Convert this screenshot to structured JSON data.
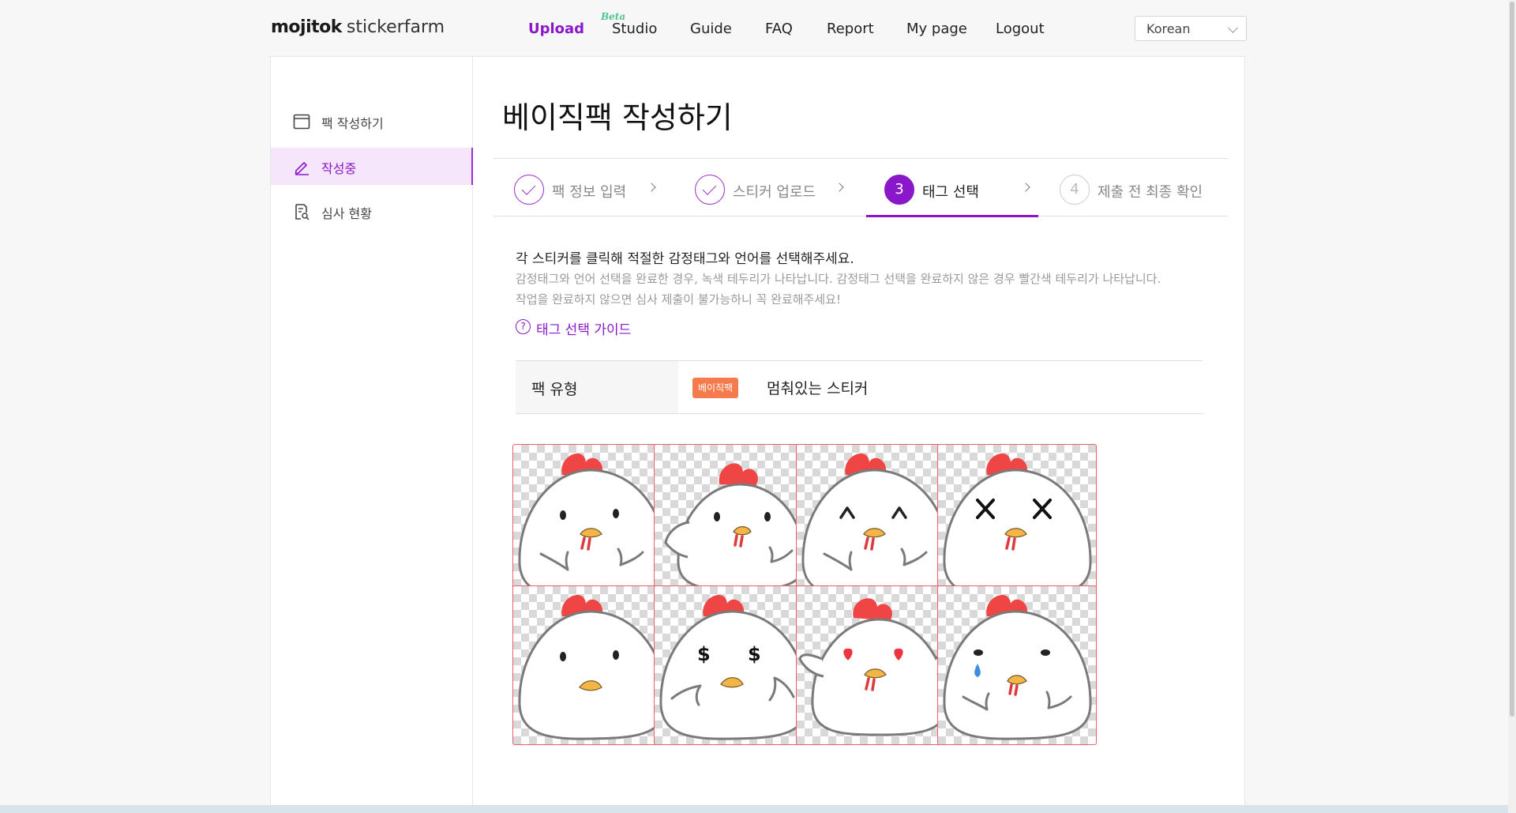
{
  "header": {
    "logo_brand": "mojitok",
    "logo_sub": "stickerfarm",
    "beta": "Beta",
    "nav": [
      {
        "label": "Upload",
        "active": true
      },
      {
        "label": "Studio"
      },
      {
        "label": "Guide"
      },
      {
        "label": "FAQ"
      },
      {
        "label": "Report"
      },
      {
        "label": "My page"
      },
      {
        "label": "Logout"
      }
    ],
    "language": "Korean"
  },
  "sidebar": {
    "items": [
      {
        "label": "팩 작성하기",
        "icon": "window-icon"
      },
      {
        "label": "작성중",
        "icon": "pencil-icon",
        "active": true
      },
      {
        "label": "심사 현황",
        "icon": "document-search-icon"
      }
    ]
  },
  "main": {
    "title": "베이직팩 작성하기",
    "steps": [
      {
        "label": "팩 정보 입력",
        "state": "done"
      },
      {
        "label": "스티커 업로드",
        "state": "done"
      },
      {
        "number": "3",
        "label": "태그 선택",
        "state": "current"
      },
      {
        "number": "4",
        "label": "제출 전 최종 확인",
        "state": "todo"
      }
    ],
    "instruction": "각 스티커를 클릭해 적절한 감정태그와 언어를 선택해주세요.",
    "desc_line1": "감정태그와 언어 선택을 완료한 경우, 녹색 테두리가 나타납니다. 감정태그 선택을 완료하지 않은 경우 빨간색 테두리가 나타납니다.",
    "desc_line2": "작업을 완료하지 않으면 심사 제출이 불가능하니 꼭 완료해주세요!",
    "guide_icon": "?",
    "guide_link": "태그 선택 가이드",
    "pack_type_label": "팩 유형",
    "pack_badge": "베이직팩",
    "pack_name": "멈춰있는 스티커"
  },
  "stickers": [
    {
      "expression": "neutral-dot-eyes",
      "status": "incomplete"
    },
    {
      "expression": "waving-wing",
      "status": "incomplete"
    },
    {
      "expression": "happy-closed-eyes",
      "status": "incomplete"
    },
    {
      "expression": "x-eyes",
      "status": "incomplete"
    },
    {
      "expression": "plain-face",
      "status": "incomplete"
    },
    {
      "expression": "dollar-eyes",
      "status": "incomplete"
    },
    {
      "expression": "heart-eyes",
      "status": "incomplete"
    },
    {
      "expression": "teardrop",
      "status": "incomplete"
    }
  ],
  "colors": {
    "accent": "#8a17c9",
    "badge": "#f57a4c",
    "incomplete_border": "#ef5f6a"
  }
}
